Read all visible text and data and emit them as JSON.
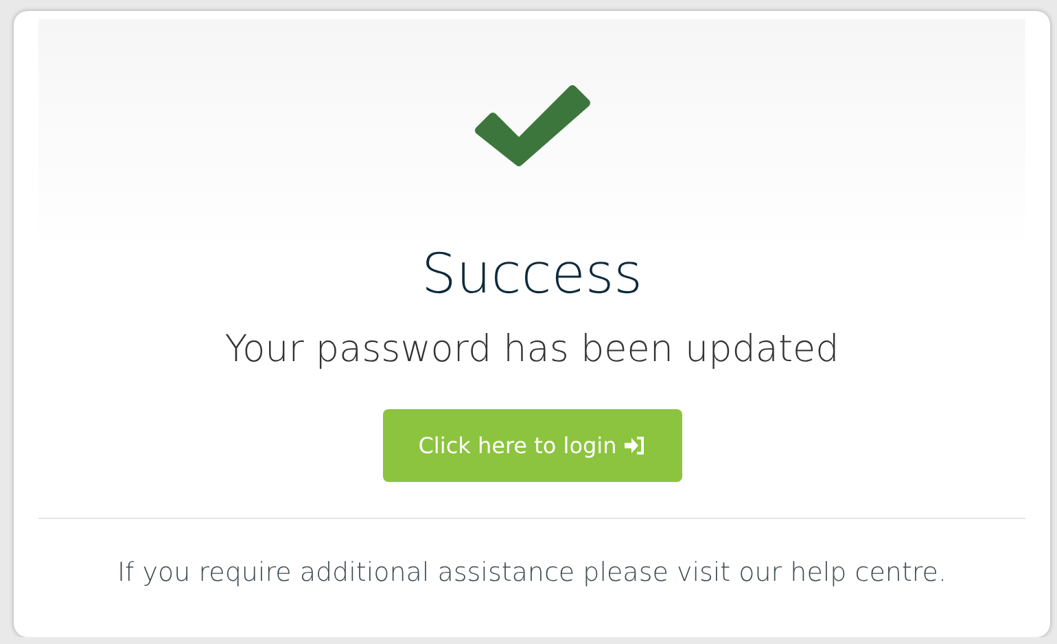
{
  "title": "Success",
  "message": "Your password has been updated",
  "button": {
    "label": "Click here to login"
  },
  "footer": "If you require additional assistance please visit our help centre."
}
